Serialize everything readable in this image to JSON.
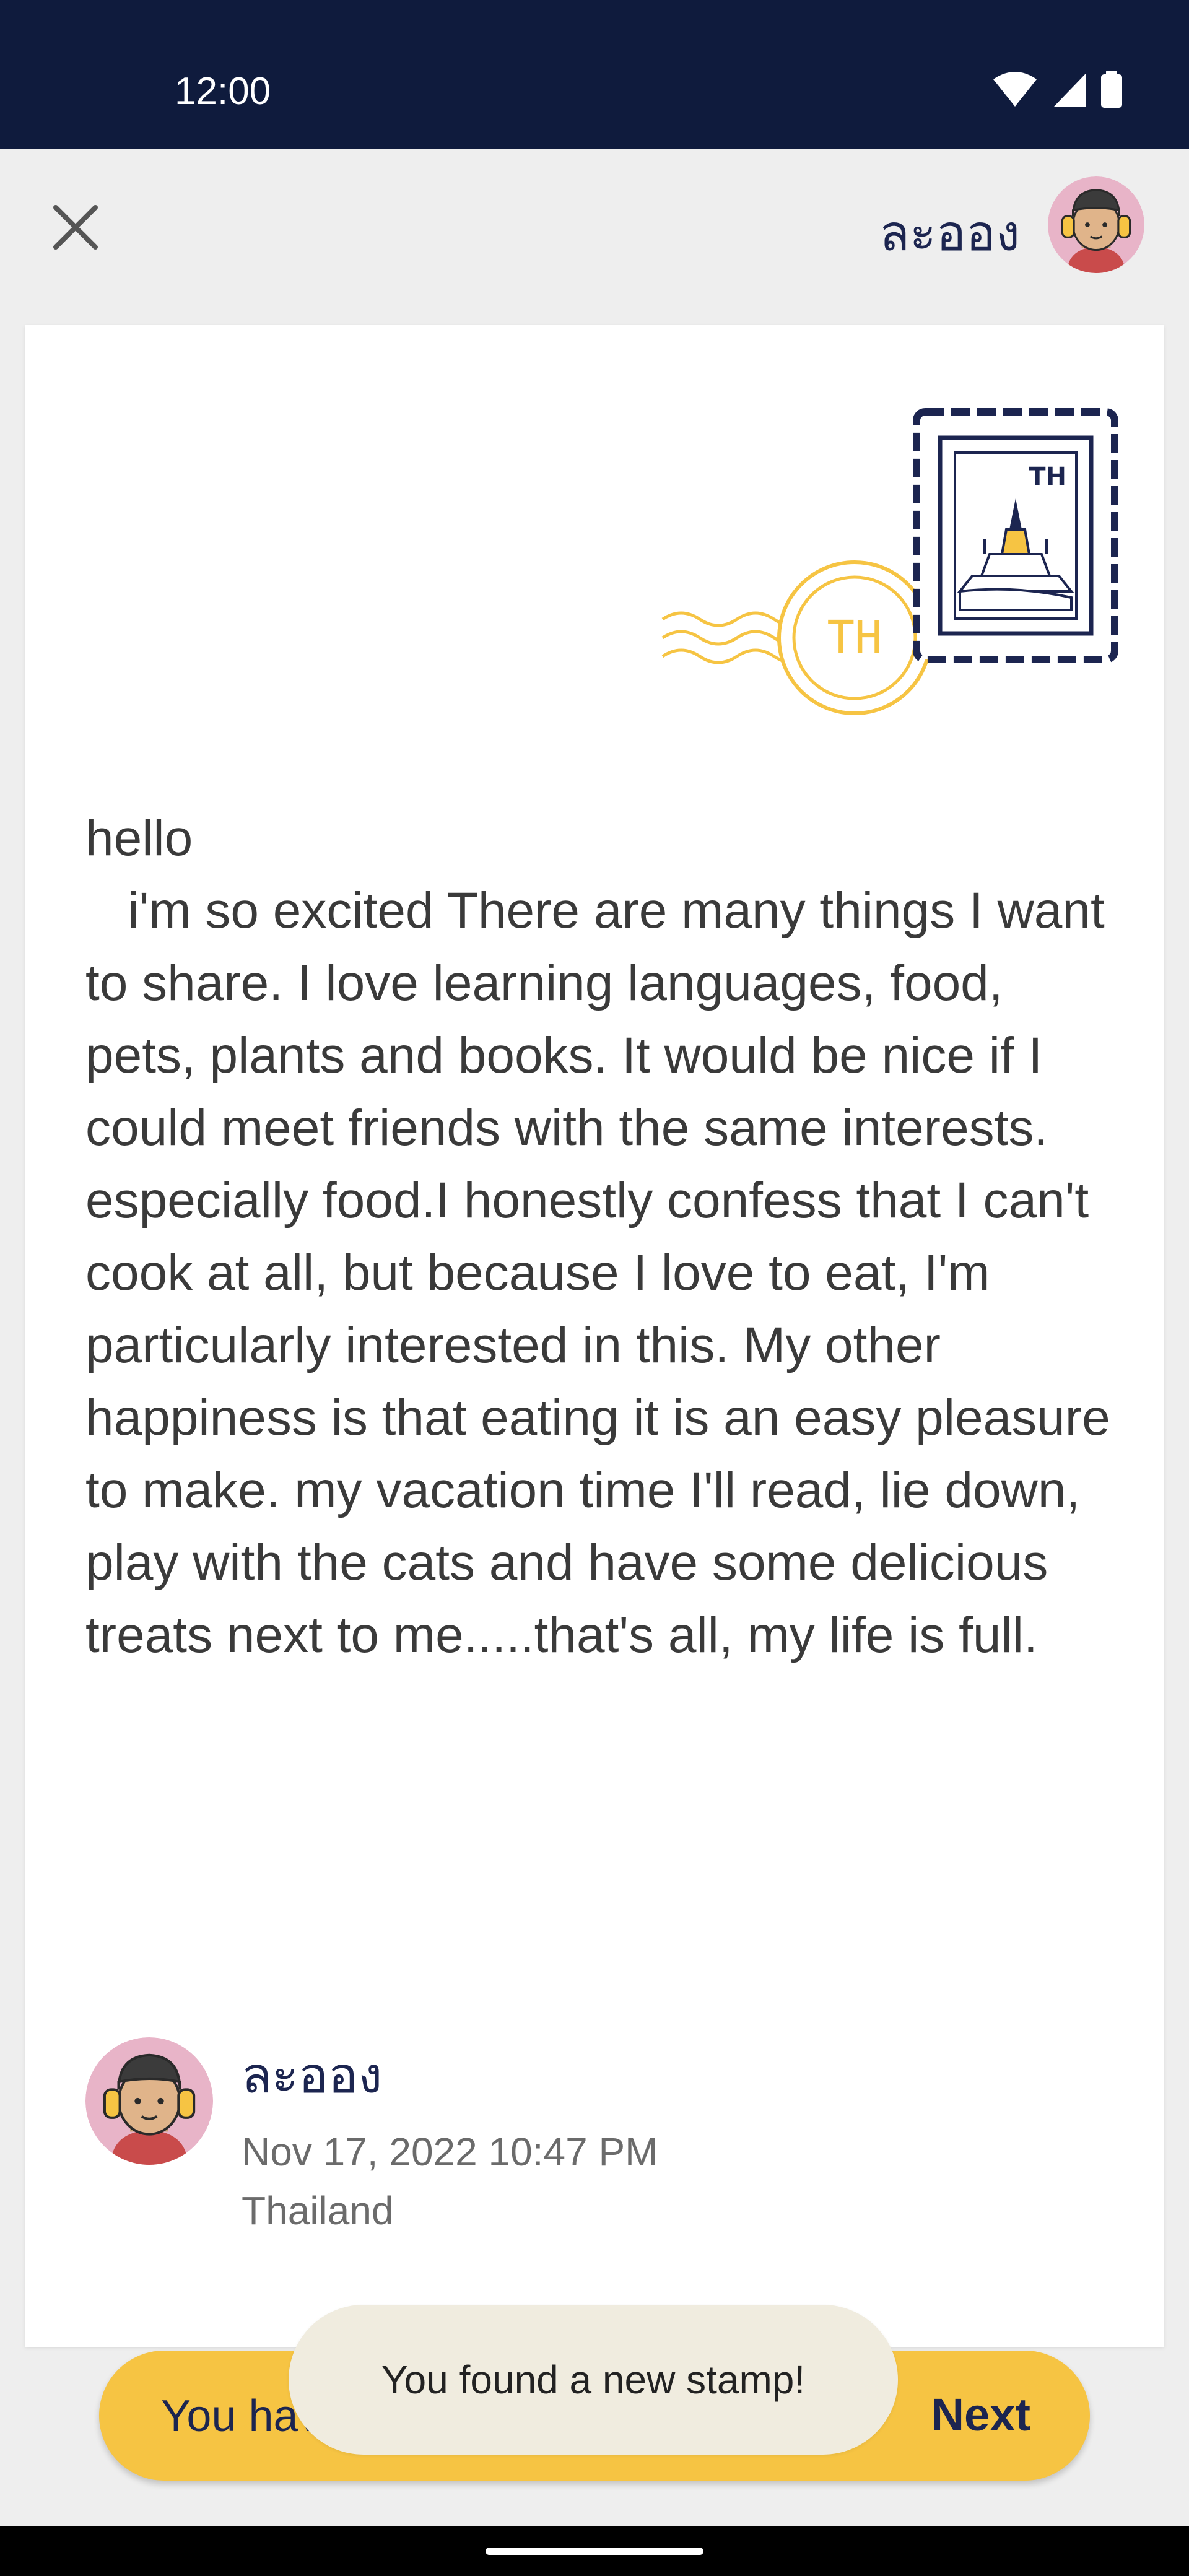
{
  "status_bar": {
    "time": "12:00",
    "icons": [
      "wifi-icon",
      "signal-icon",
      "battery-icon"
    ]
  },
  "header": {
    "close_icon": "close-icon",
    "sender_name": "ละออง"
  },
  "stamp": {
    "country_code": "TH",
    "postmark_code": "TH"
  },
  "letter": {
    "body": "hello\n   i'm so excited There are many things I want to share. I love learning languages, food, pets, plants and books. It would be nice if I could meet friends with the same interests. especially food.I honestly confess that I can't cook at all, but because I love to eat, I'm particularly interested in this. My other happiness is that eating it is an easy pleasure to make. my vacation time I'll read, lie down, play with the cats and have some delicious treats next to me.....that's all, my life is full."
  },
  "signature": {
    "name": "ละออง",
    "date": "Nov 17, 2022 10:47 PM",
    "country": "Thailand"
  },
  "friend_bar": {
    "text": "You have a new friend!",
    "next_label": "Next"
  },
  "toast": {
    "text": "You found a new stamp!"
  },
  "colors": {
    "navy": "#0f1b3d",
    "accent_yellow": "#f6c443",
    "stamp_navy": "#1c2550",
    "avatar_pink": "#e8b4c8"
  }
}
